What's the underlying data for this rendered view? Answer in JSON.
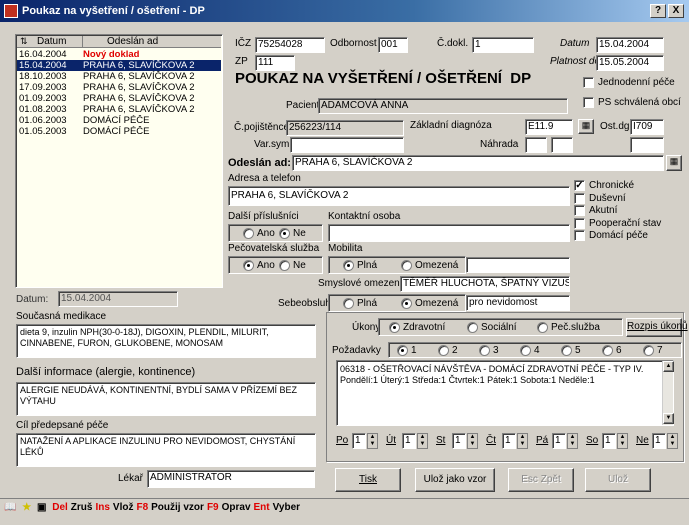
{
  "window": {
    "title": "Poukaz na vyšetření / ošetření - DP",
    "help_btn": "?",
    "close_btn": "X"
  },
  "list": {
    "col_datum": "Datum",
    "col_odeslan": "Odeslán ad",
    "rows": [
      {
        "datum": "16.04.2004",
        "odeslan": "Nový doklad",
        "kind": "new"
      },
      {
        "datum": "15.04.2004",
        "odeslan": "PRAHA 6, SLAVÍČKOVA 2",
        "kind": "sel"
      },
      {
        "datum": "18.10.2003",
        "odeslan": "PRAHA 6, SLAVÍČKOVA 2",
        "kind": "n"
      },
      {
        "datum": "17.09.2003",
        "odeslan": "PRAHA 6, SLAVÍČKOVA 2",
        "kind": "n"
      },
      {
        "datum": "01.09.2003",
        "odeslan": "PRAHA 6, SLAVÍČKOVA 2",
        "kind": "n"
      },
      {
        "datum": "01.08.2003",
        "odeslan": "PRAHA 6, SLAVÍČKOVA 2",
        "kind": "n"
      },
      {
        "datum": "01.06.2003",
        "odeslan": "DOMÁCÍ PÉČE",
        "kind": "n"
      },
      {
        "datum": "01.05.2003",
        "odeslan": "DOMÁCÍ PÉČE",
        "kind": "n"
      }
    ]
  },
  "datum_bottom": {
    "label": "Datum:",
    "value": "15.04.2004"
  },
  "header": {
    "icz_label": "IČZ",
    "icz": "75254028",
    "odbornost_label": "Odbornost",
    "odbornost": "001",
    "cdokl_label": "Č.dokl.",
    "cdokl": "1",
    "datum_label": "Datum",
    "datum": "15.04.2004",
    "zp_label": "ZP",
    "zp": "111",
    "platnost_label": "Platnost do",
    "platnost": "15.05.2004",
    "title": "POUKAZ NA VYŠETŘENÍ / OŠETŘENÍ  DP",
    "jednodenni": "Jednodenní péče",
    "ps": "PS schválená obcí"
  },
  "patient": {
    "pacient_label": "Pacient",
    "pacient": "ADAMCOVÁ ANNA",
    "cpoj_label": "Č.pojištěnce",
    "cpoj": "256223/114",
    "zakl_label": "Základní diagnóza",
    "zakl": "E11.9",
    "ostdg_label": "Ost.dg",
    "ostdg": "I709",
    "varsym_label": "Var.symbol",
    "varsym": "",
    "nahrada_label": "Náhrada"
  },
  "odeslan": {
    "label": "Odeslán ad:",
    "value": "PRAHA 6, SLAVÍČKOVA 2"
  },
  "adresa": {
    "label": "Adresa a telefon",
    "value": "PRAHA 6, SLAVÍČKOVA 2"
  },
  "dalsi_prisl": {
    "label": "Další příslušníci",
    "ano": "Ano",
    "ne": "Ne",
    "kontakt_label": "Kontaktní osoba",
    "kontakt": ""
  },
  "pecovatel": {
    "label": "Pečovatelská služba",
    "ano": "Ano",
    "ne": "Ne",
    "mobilita_label": "Mobilita",
    "plna": "Plná",
    "omezena": "Omezená",
    "mob_value": ""
  },
  "smysl": {
    "label": "Smyslové omezení",
    "value": "TĚMĚŘ HLUCHOTA, ŠPATNÝ VIZUS"
  },
  "sebeob": {
    "label": "Sebeobsluha",
    "plna": "Plná",
    "omezena": "Omezená",
    "value": "pro nevidomost"
  },
  "checks": [
    "Chronické",
    "Duševní",
    "Akutní",
    "Pooperační stav",
    "Domácí péče"
  ],
  "soucasna": {
    "label": "Současná medikace",
    "value": "dieta 9, inzulin NPH(30-0-18J), DIGOXIN, PLENDIL, MILURIT, CINNABENE, FURON, GLUKOBENE, MONOSAM"
  },
  "dalsi_info": {
    "label": "Další informace (alergie, kontinence)",
    "value": "ALERGIE NEUDÁVÁ, KONTINENTNÍ, BYDLÍ SAMA V PŘÍZEMÍ BEZ VÝTAHU"
  },
  "cil": {
    "label": "Cíl předepsané péče",
    "value": "NATAŽENÍ A APLIKACE INZULINU PRO NEVIDOMOST, CHYSTÁNÍ LÉKŮ"
  },
  "lekar": {
    "label": "Lékař",
    "value": "ADMINISTRATOR"
  },
  "ukony": {
    "label": "Úkony",
    "zdrav": "Zdravotní",
    "soc": "Sociální",
    "pec": "Peč.služba",
    "rozpis": "Rozpis úkonů",
    "pozad_label": "Požadavky",
    "pozad": [
      "1",
      "2",
      "3",
      "4",
      "5",
      "6",
      "7"
    ],
    "text": "06318 - OŠETŘOVACÍ NÁVŠTĚVA - DOMÁCÍ ZDRAVOTNÍ PÉČE - TYP IV. Pondělí:1 Úterý:1 Středa:1 Čtvrtek:1 Pátek:1 Sobota:1 Neděle:1",
    "days": [
      {
        "d": "Po",
        "v": "1"
      },
      {
        "d": "Út",
        "v": "1"
      },
      {
        "d": "St",
        "v": "1"
      },
      {
        "d": "Čt",
        "v": "1"
      },
      {
        "d": "Pá",
        "v": "1"
      },
      {
        "d": "So",
        "v": "1"
      },
      {
        "d": "Ne",
        "v": "1"
      }
    ]
  },
  "buttons": {
    "tisk": "Tisk",
    "uloz_vzor": "Ulož jako vzor",
    "esc": "Esc Zpět",
    "uloz": "Ulož"
  },
  "statusbar": [
    {
      "k": "Del",
      "t": "Zruš"
    },
    {
      "k": "Ins",
      "t": "Vlož"
    },
    {
      "k": "F8",
      "t": "Použij vzor"
    },
    {
      "k": "F9",
      "t": "Oprav"
    },
    {
      "k": "Ent",
      "t": "Vyber"
    }
  ],
  "colors": {
    "title_bg": "#0a246a",
    "sel_bg": "#0a246a",
    "new_text": "#e00000",
    "face": "#d4d0c8"
  }
}
